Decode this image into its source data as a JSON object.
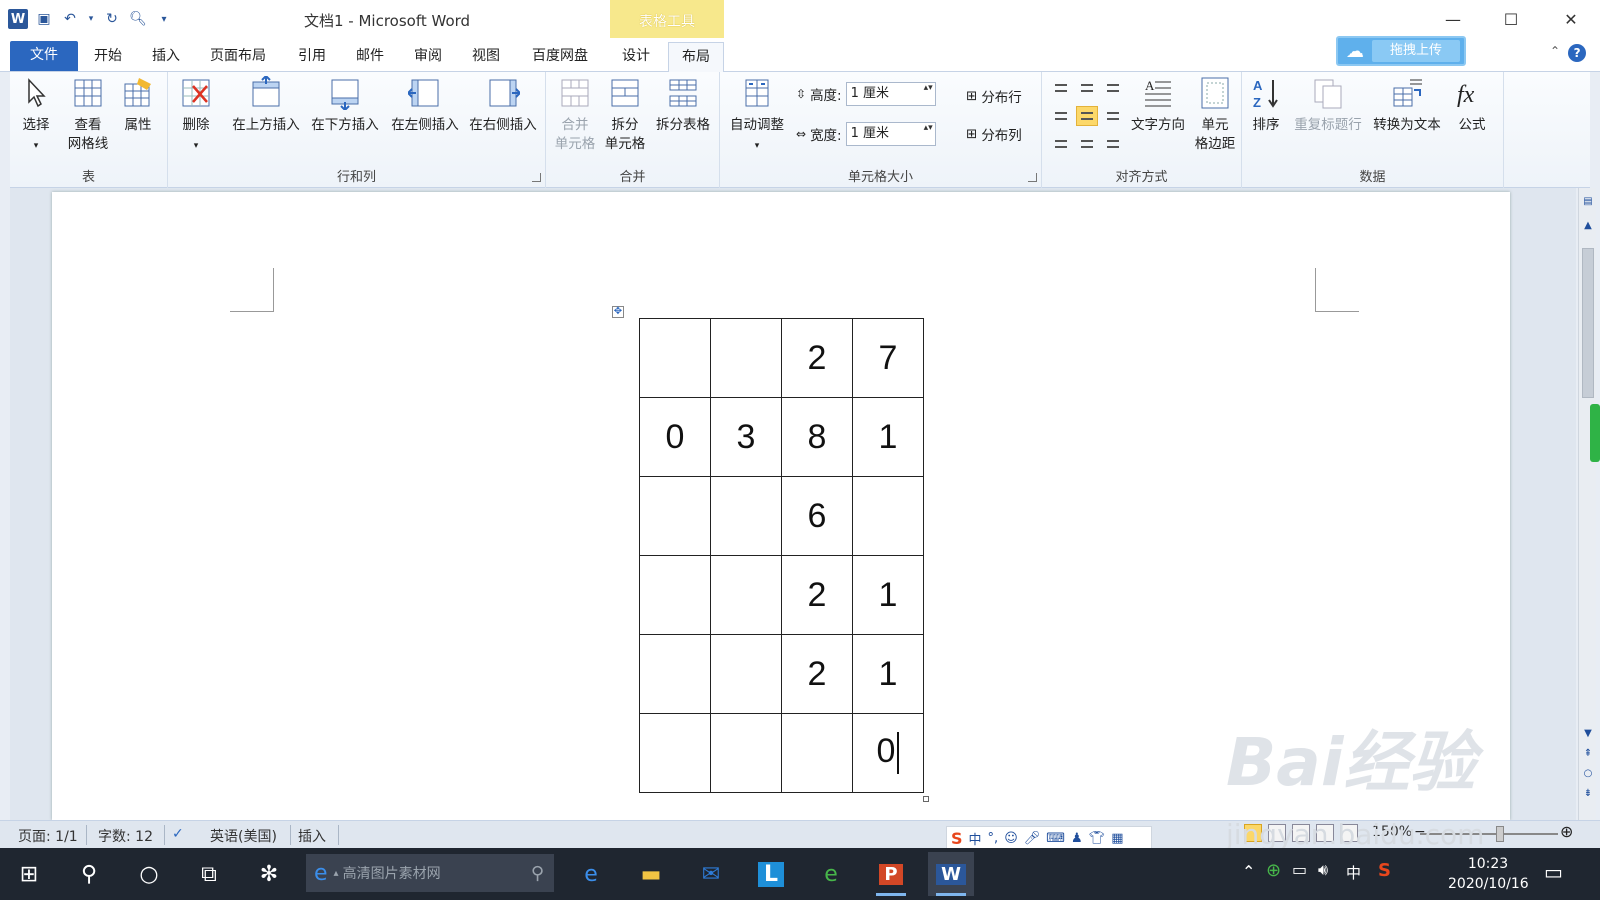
{
  "window": {
    "title": "文档1 - Microsoft Word",
    "context_tab_group": "表格工具",
    "controls": {
      "minimize": "—",
      "maximize": "☐",
      "close": "✕"
    }
  },
  "quick_access": {
    "app_icon": "W"
  },
  "tabs": [
    {
      "label": "文件"
    },
    {
      "label": "开始"
    },
    {
      "label": "插入"
    },
    {
      "label": "页面布局"
    },
    {
      "label": "引用"
    },
    {
      "label": "邮件"
    },
    {
      "label": "审阅"
    },
    {
      "label": "视图"
    },
    {
      "label": "百度网盘"
    },
    {
      "label": "设计"
    },
    {
      "label": "布局"
    }
  ],
  "active_tab": "布局",
  "upload_button": "拖拽上传",
  "ribbon": {
    "table_group": {
      "label": "表",
      "select": "选择",
      "view_gridlines_1": "查看",
      "view_gridlines_2": "网格线",
      "properties": "属性"
    },
    "rows_cols_group": {
      "label": "行和列",
      "delete": "删除",
      "insert_above": "在上方插入",
      "insert_below": "在下方插入",
      "insert_left": "在左侧插入",
      "insert_right": "在右侧插入"
    },
    "merge_group": {
      "label": "合并",
      "merge_cells_1": "合并",
      "merge_cells_2": "单元格",
      "split_cells_1": "拆分",
      "split_cells_2": "单元格",
      "split_table": "拆分表格"
    },
    "cell_size_group": {
      "label": "单元格大小",
      "autofit": "自动调整",
      "height_label": "高度:",
      "height_value": "1 厘米",
      "width_label": "宽度:",
      "width_value": "1 厘米",
      "distribute_rows": "分布行",
      "distribute_cols": "分布列"
    },
    "alignment_group": {
      "label": "对齐方式",
      "text_direction": "文字方向",
      "cell_margins_1": "单元",
      "cell_margins_2": "格边距"
    },
    "data_group": {
      "label": "数据",
      "sort": "排序",
      "repeat_header": "重复标题行",
      "convert_to_text": "转换为文本",
      "formula": "公式"
    }
  },
  "document": {
    "table": [
      [
        "",
        "",
        "2",
        "7"
      ],
      [
        "0",
        "3",
        "8",
        "1"
      ],
      [
        "",
        "",
        "6",
        ""
      ],
      [
        "",
        "",
        "2",
        "1"
      ],
      [
        "",
        "",
        "2",
        "1"
      ],
      [
        "",
        "",
        "",
        "0"
      ]
    ]
  },
  "statusbar": {
    "page": "页面: 1/1",
    "words": "字数: 12",
    "language": "英语(美国)",
    "mode": "插入",
    "zoom": "150%"
  },
  "ime": {
    "lang": "中"
  },
  "watermark": {
    "brand": "Bai经验",
    "url": "jingyan.baidu.com"
  },
  "taskbar": {
    "search_placeholder": "高清图片素材网",
    "tray_lang": "中",
    "time": "10:23",
    "date": "2020/10/16"
  }
}
